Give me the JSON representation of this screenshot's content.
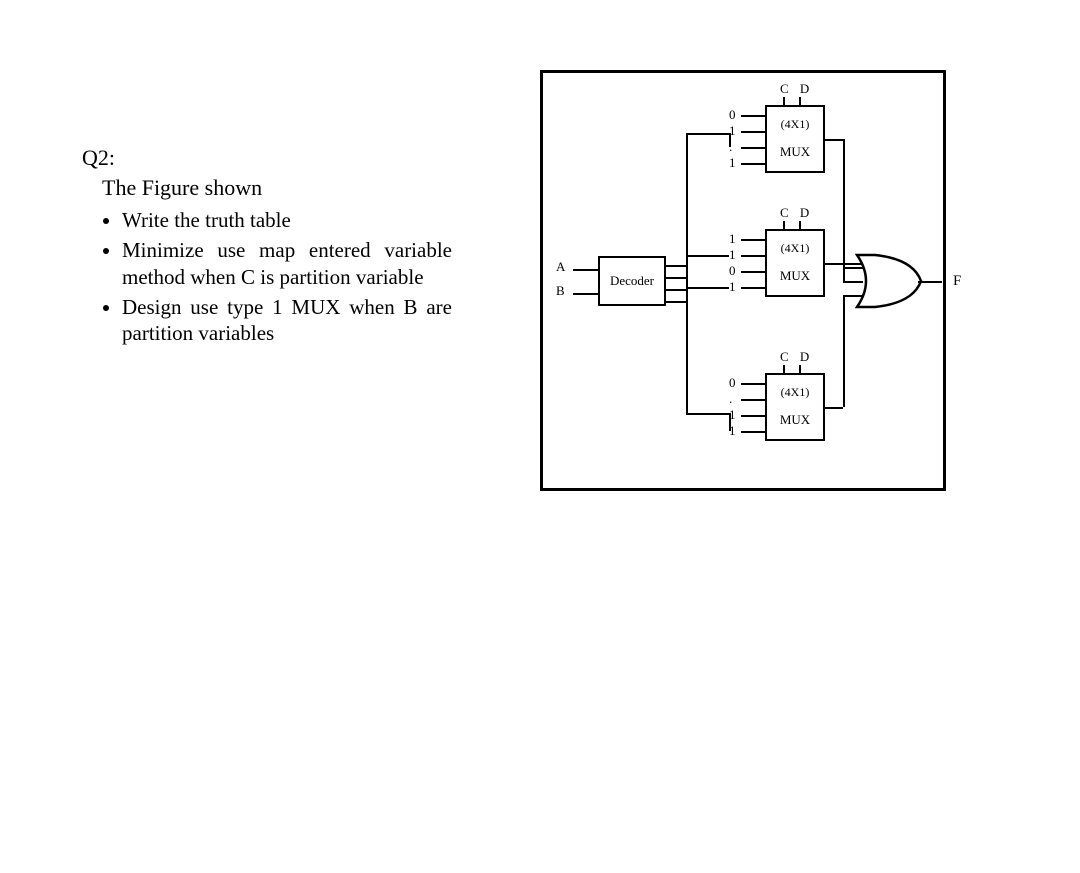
{
  "question": {
    "title": "Q2:",
    "subtitle": "The Figure shown",
    "bullets": [
      "Write the truth table",
      "Minimize use map entered variable method when C is partition variable",
      "Design use type 1 MUX when B are partition variables"
    ]
  },
  "circuit": {
    "decoder": {
      "label": "Decoder",
      "inputs": [
        "A",
        "B"
      ]
    },
    "select_label": "C D",
    "mux": {
      "type": "(4X1)",
      "name": "MUX"
    },
    "mux_inputs": {
      "top": [
        "0",
        "1",
        ".",
        "1"
      ],
      "middle": [
        "1",
        "1",
        "0",
        "1"
      ],
      "bottom": [
        "0",
        ".",
        "1",
        "1"
      ]
    },
    "output": "F"
  }
}
